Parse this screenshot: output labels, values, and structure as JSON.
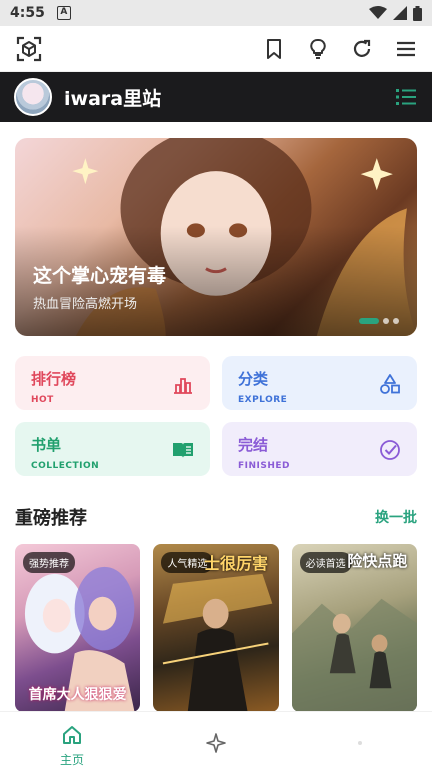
{
  "status": {
    "time": "4:55",
    "badge": "A"
  },
  "site": {
    "title": "iwara里站"
  },
  "banner": {
    "title": "这个掌心宠有毒",
    "subtitle": "热血冒险高燃开场"
  },
  "categories": [
    {
      "name": "排行榜",
      "sub": "HOT"
    },
    {
      "name": "分类",
      "sub": "EXPLORE"
    },
    {
      "name": "书单",
      "sub": "COLLECTION"
    },
    {
      "name": "完结",
      "sub": "FINISHED"
    }
  ],
  "section": {
    "title": "重磅推荐",
    "more": "换一批"
  },
  "books": [
    {
      "tag": "强势推荐",
      "cover_text": "首席大人狠狠爱"
    },
    {
      "tag": "人气精选",
      "cover_text": "士很厉害"
    },
    {
      "tag": "必读首选",
      "cover_text": "险快点跑"
    }
  ],
  "tabs": [
    {
      "label": "主页"
    },
    {
      "label": ""
    },
    {
      "label": ""
    }
  ],
  "colors": {
    "accent": "#2aa37f",
    "hot": "#e0485c",
    "explore": "#3f72d8",
    "collection": "#21a06e",
    "finished": "#8a5bd6"
  }
}
